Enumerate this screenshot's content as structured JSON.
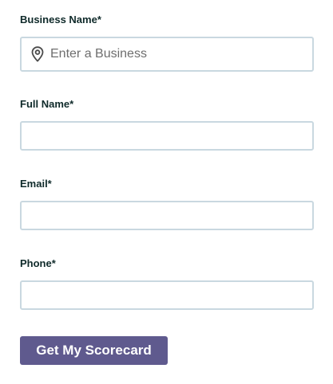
{
  "form": {
    "business": {
      "label": "Business Name*",
      "placeholder": "Enter a Business",
      "value": ""
    },
    "full_name": {
      "label": "Full Name*",
      "placeholder": "",
      "value": ""
    },
    "email": {
      "label": "Email*",
      "placeholder": "",
      "value": ""
    },
    "phone": {
      "label": "Phone*",
      "placeholder": "",
      "value": ""
    },
    "submit_label": "Get My Scorecard"
  },
  "icons": {
    "business_field_icon": "map-pin-icon"
  },
  "colors": {
    "button_bg": "#5f5a8e",
    "field_border": "#c9d8e0",
    "label_text": "#0f2a2a"
  }
}
